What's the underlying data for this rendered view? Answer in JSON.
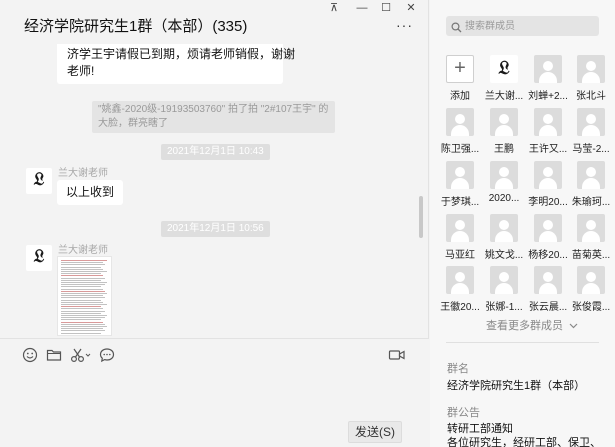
{
  "window": {
    "pin": "⊼",
    "minimize": "—",
    "maximize": "☐",
    "close": "✕"
  },
  "chat": {
    "title": "经济学院研究生1群（本部）(335)",
    "more": "···",
    "messages": {
      "first_line1": "济学王宇请假已到期，烦请老师销假，谢谢",
      "first_line2": "老师!",
      "sys_note_line1": "\"姚鑫-2020级-19193503760\" 拍了拍 \"2#107王宇\" 的",
      "sys_note_line2": "大脸，群亮瞎了",
      "time1": "2021年12月1日 10:43",
      "sender1": "兰大谢老师",
      "text1": "以上收到",
      "time2": "2021年12月1日 10:56",
      "sender2": "兰大谢老师"
    },
    "toolbar": {
      "emoji_icon": "smile-icon",
      "folder_icon": "folder-icon",
      "scissors_icon": "scissors-icon",
      "chat_icon": "chat-bubble-icon",
      "video_icon": "video-call-icon"
    },
    "send_label": "发送(S)"
  },
  "members": {
    "search_placeholder": "搜索群成员",
    "list": [
      {
        "name": "添加",
        "kind": "add"
      },
      {
        "name": "兰大谢...",
        "kind": "cal"
      },
      {
        "name": "刘蝉+2...",
        "kind": "default"
      },
      {
        "name": "张北斗",
        "kind": "default"
      },
      {
        "name": "陈卫强...",
        "kind": "default"
      },
      {
        "name": "王鹏",
        "kind": "default"
      },
      {
        "name": "王许又...",
        "kind": "default"
      },
      {
        "name": "马莹-2...",
        "kind": "default"
      },
      {
        "name": "于梦琪...",
        "kind": "default"
      },
      {
        "name": "2020...",
        "kind": "default"
      },
      {
        "name": "李明20...",
        "kind": "default"
      },
      {
        "name": "朱瑜珂...",
        "kind": "default"
      },
      {
        "name": "马亚红",
        "kind": "default"
      },
      {
        "name": "姚文戈...",
        "kind": "default"
      },
      {
        "name": "杨移20...",
        "kind": "default"
      },
      {
        "name": "苗菊英...",
        "kind": "default"
      },
      {
        "name": "王徽20...",
        "kind": "default"
      },
      {
        "name": "张娜-1...",
        "kind": "default"
      },
      {
        "name": "张云晨...",
        "kind": "default"
      },
      {
        "name": "张俊霞...",
        "kind": "default"
      }
    ],
    "view_more": "查看更多群成员",
    "group_name_label": "群名",
    "group_name": "经济学院研究生1群（本部）",
    "notice_label": "群公告",
    "notice_line1": "转研工部通知",
    "notice_line2": "各位研究生，经研工部、保卫、"
  }
}
